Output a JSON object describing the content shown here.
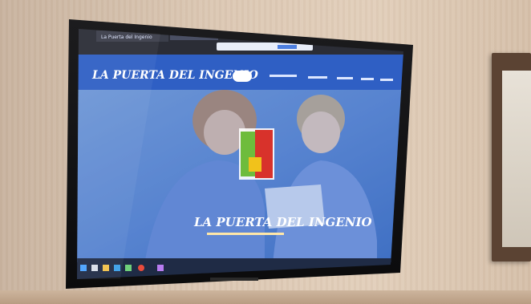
{
  "scene": {
    "description_colors": {
      "wall": "#dcc8b4",
      "bezel": "#141414",
      "site_nav": "#2f5fc4",
      "accent_red": "#d8322b",
      "accent_yellow": "#f1c21b",
      "accent_green": "#6ebc3c"
    }
  },
  "browser": {
    "tab_title": "La Puerta del Ingenio",
    "search_placeholder": ""
  },
  "site": {
    "logo_text": "LA PUERTA DEL INGENIO",
    "hero_title": "LA PUERTA DEL INGENIO",
    "nav_items": [
      "",
      "",
      "",
      "",
      "",
      ""
    ]
  },
  "icons": {
    "taskbar": [
      "windows-icon",
      "search-icon",
      "task-view-icon",
      "edge-icon",
      "folder-icon",
      "store-icon",
      "chrome-icon"
    ]
  }
}
